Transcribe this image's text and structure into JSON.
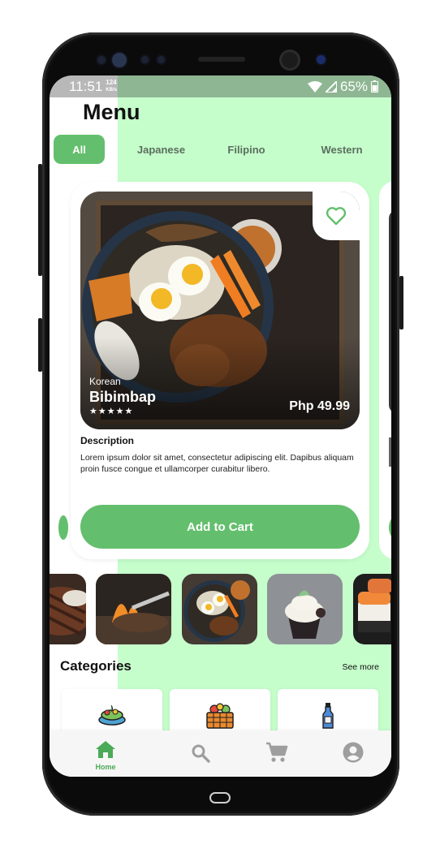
{
  "status_bar": {
    "time": "11:51",
    "speed": "124",
    "speed_unit": "KB/s",
    "battery": "65%"
  },
  "header": {
    "title": "Menu"
  },
  "tabs": [
    {
      "label": "All",
      "active": true
    },
    {
      "label": "Japanese",
      "active": false
    },
    {
      "label": "Filipino",
      "active": false
    },
    {
      "label": "Western",
      "active": false
    }
  ],
  "featured": {
    "origin": "Korean",
    "name": "Bibimbap",
    "stars": "★★★★★",
    "price": "Php 49.99",
    "description_title": "Description",
    "description": "Lorem ipsum dolor sit amet, consectetur adipiscing elit. Dapibus aliquam proin fusce congue et ullamcorper curabitur libero.",
    "add_to_cart_label": "Add to Cart"
  },
  "categories": {
    "heading": "Categories",
    "see_more": "See more"
  },
  "nav": {
    "home_label": "Home"
  },
  "colors": {
    "accent": "#63bf6d",
    "panel": "#c5fdcb",
    "nav_active": "#4aaa57",
    "nav_inactive": "#9e9e9e"
  },
  "icons": [
    "heart-icon",
    "home-icon",
    "search-icon",
    "cart-icon",
    "profile-icon",
    "salad-icon",
    "fruit-basket-icon",
    "bottle-icon"
  ]
}
